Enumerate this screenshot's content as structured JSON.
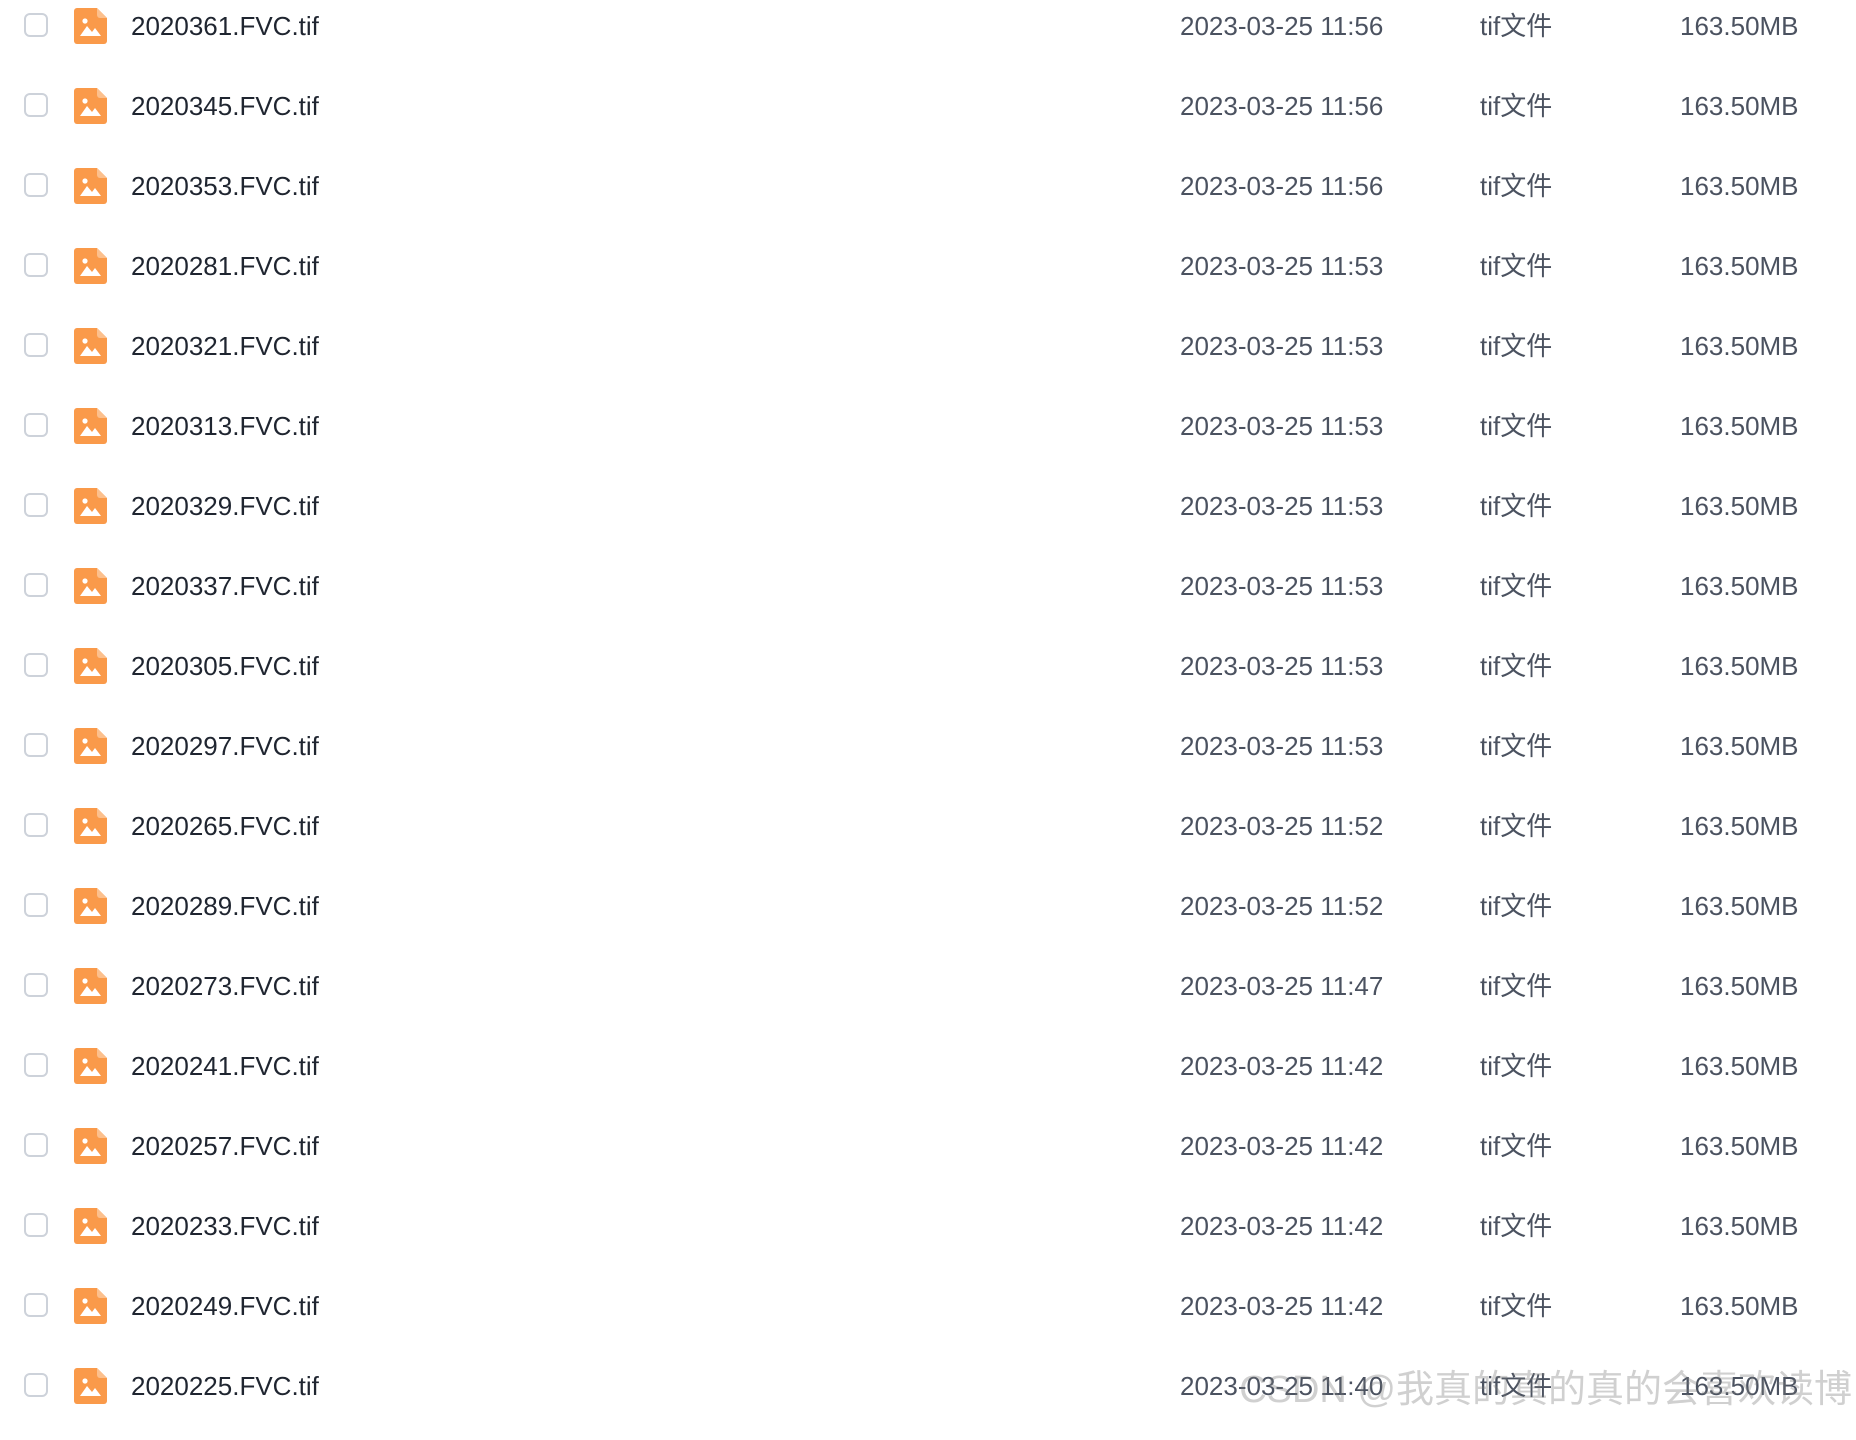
{
  "colors": {
    "icon_bg": "#fa9a4a",
    "icon_fold": "#fcc08d",
    "checkbox_border": "#cdd2da"
  },
  "file_icon": "image-file-icon",
  "files": [
    {
      "name": "2020361.FVC.tif",
      "time": "2023-03-25 11:56",
      "type": "tif文件",
      "size": "163.50MB"
    },
    {
      "name": "2020345.FVC.tif",
      "time": "2023-03-25 11:56",
      "type": "tif文件",
      "size": "163.50MB"
    },
    {
      "name": "2020353.FVC.tif",
      "time": "2023-03-25 11:56",
      "type": "tif文件",
      "size": "163.50MB"
    },
    {
      "name": "2020281.FVC.tif",
      "time": "2023-03-25 11:53",
      "type": "tif文件",
      "size": "163.50MB"
    },
    {
      "name": "2020321.FVC.tif",
      "time": "2023-03-25 11:53",
      "type": "tif文件",
      "size": "163.50MB"
    },
    {
      "name": "2020313.FVC.tif",
      "time": "2023-03-25 11:53",
      "type": "tif文件",
      "size": "163.50MB"
    },
    {
      "name": "2020329.FVC.tif",
      "time": "2023-03-25 11:53",
      "type": "tif文件",
      "size": "163.50MB"
    },
    {
      "name": "2020337.FVC.tif",
      "time": "2023-03-25 11:53",
      "type": "tif文件",
      "size": "163.50MB"
    },
    {
      "name": "2020305.FVC.tif",
      "time": "2023-03-25 11:53",
      "type": "tif文件",
      "size": "163.50MB"
    },
    {
      "name": "2020297.FVC.tif",
      "time": "2023-03-25 11:53",
      "type": "tif文件",
      "size": "163.50MB"
    },
    {
      "name": "2020265.FVC.tif",
      "time": "2023-03-25 11:52",
      "type": "tif文件",
      "size": "163.50MB"
    },
    {
      "name": "2020289.FVC.tif",
      "time": "2023-03-25 11:52",
      "type": "tif文件",
      "size": "163.50MB"
    },
    {
      "name": "2020273.FVC.tif",
      "time": "2023-03-25 11:47",
      "type": "tif文件",
      "size": "163.50MB"
    },
    {
      "name": "2020241.FVC.tif",
      "time": "2023-03-25 11:42",
      "type": "tif文件",
      "size": "163.50MB"
    },
    {
      "name": "2020257.FVC.tif",
      "time": "2023-03-25 11:42",
      "type": "tif文件",
      "size": "163.50MB"
    },
    {
      "name": "2020233.FVC.tif",
      "time": "2023-03-25 11:42",
      "type": "tif文件",
      "size": "163.50MB"
    },
    {
      "name": "2020249.FVC.tif",
      "time": "2023-03-25 11:42",
      "type": "tif文件",
      "size": "163.50MB"
    },
    {
      "name": "2020225.FVC.tif",
      "time": "2023-03-25 11:40",
      "type": "tif文件",
      "size": "163.50MB"
    }
  ],
  "watermark": "CSDN @我真的真的真的会喜欢读博"
}
